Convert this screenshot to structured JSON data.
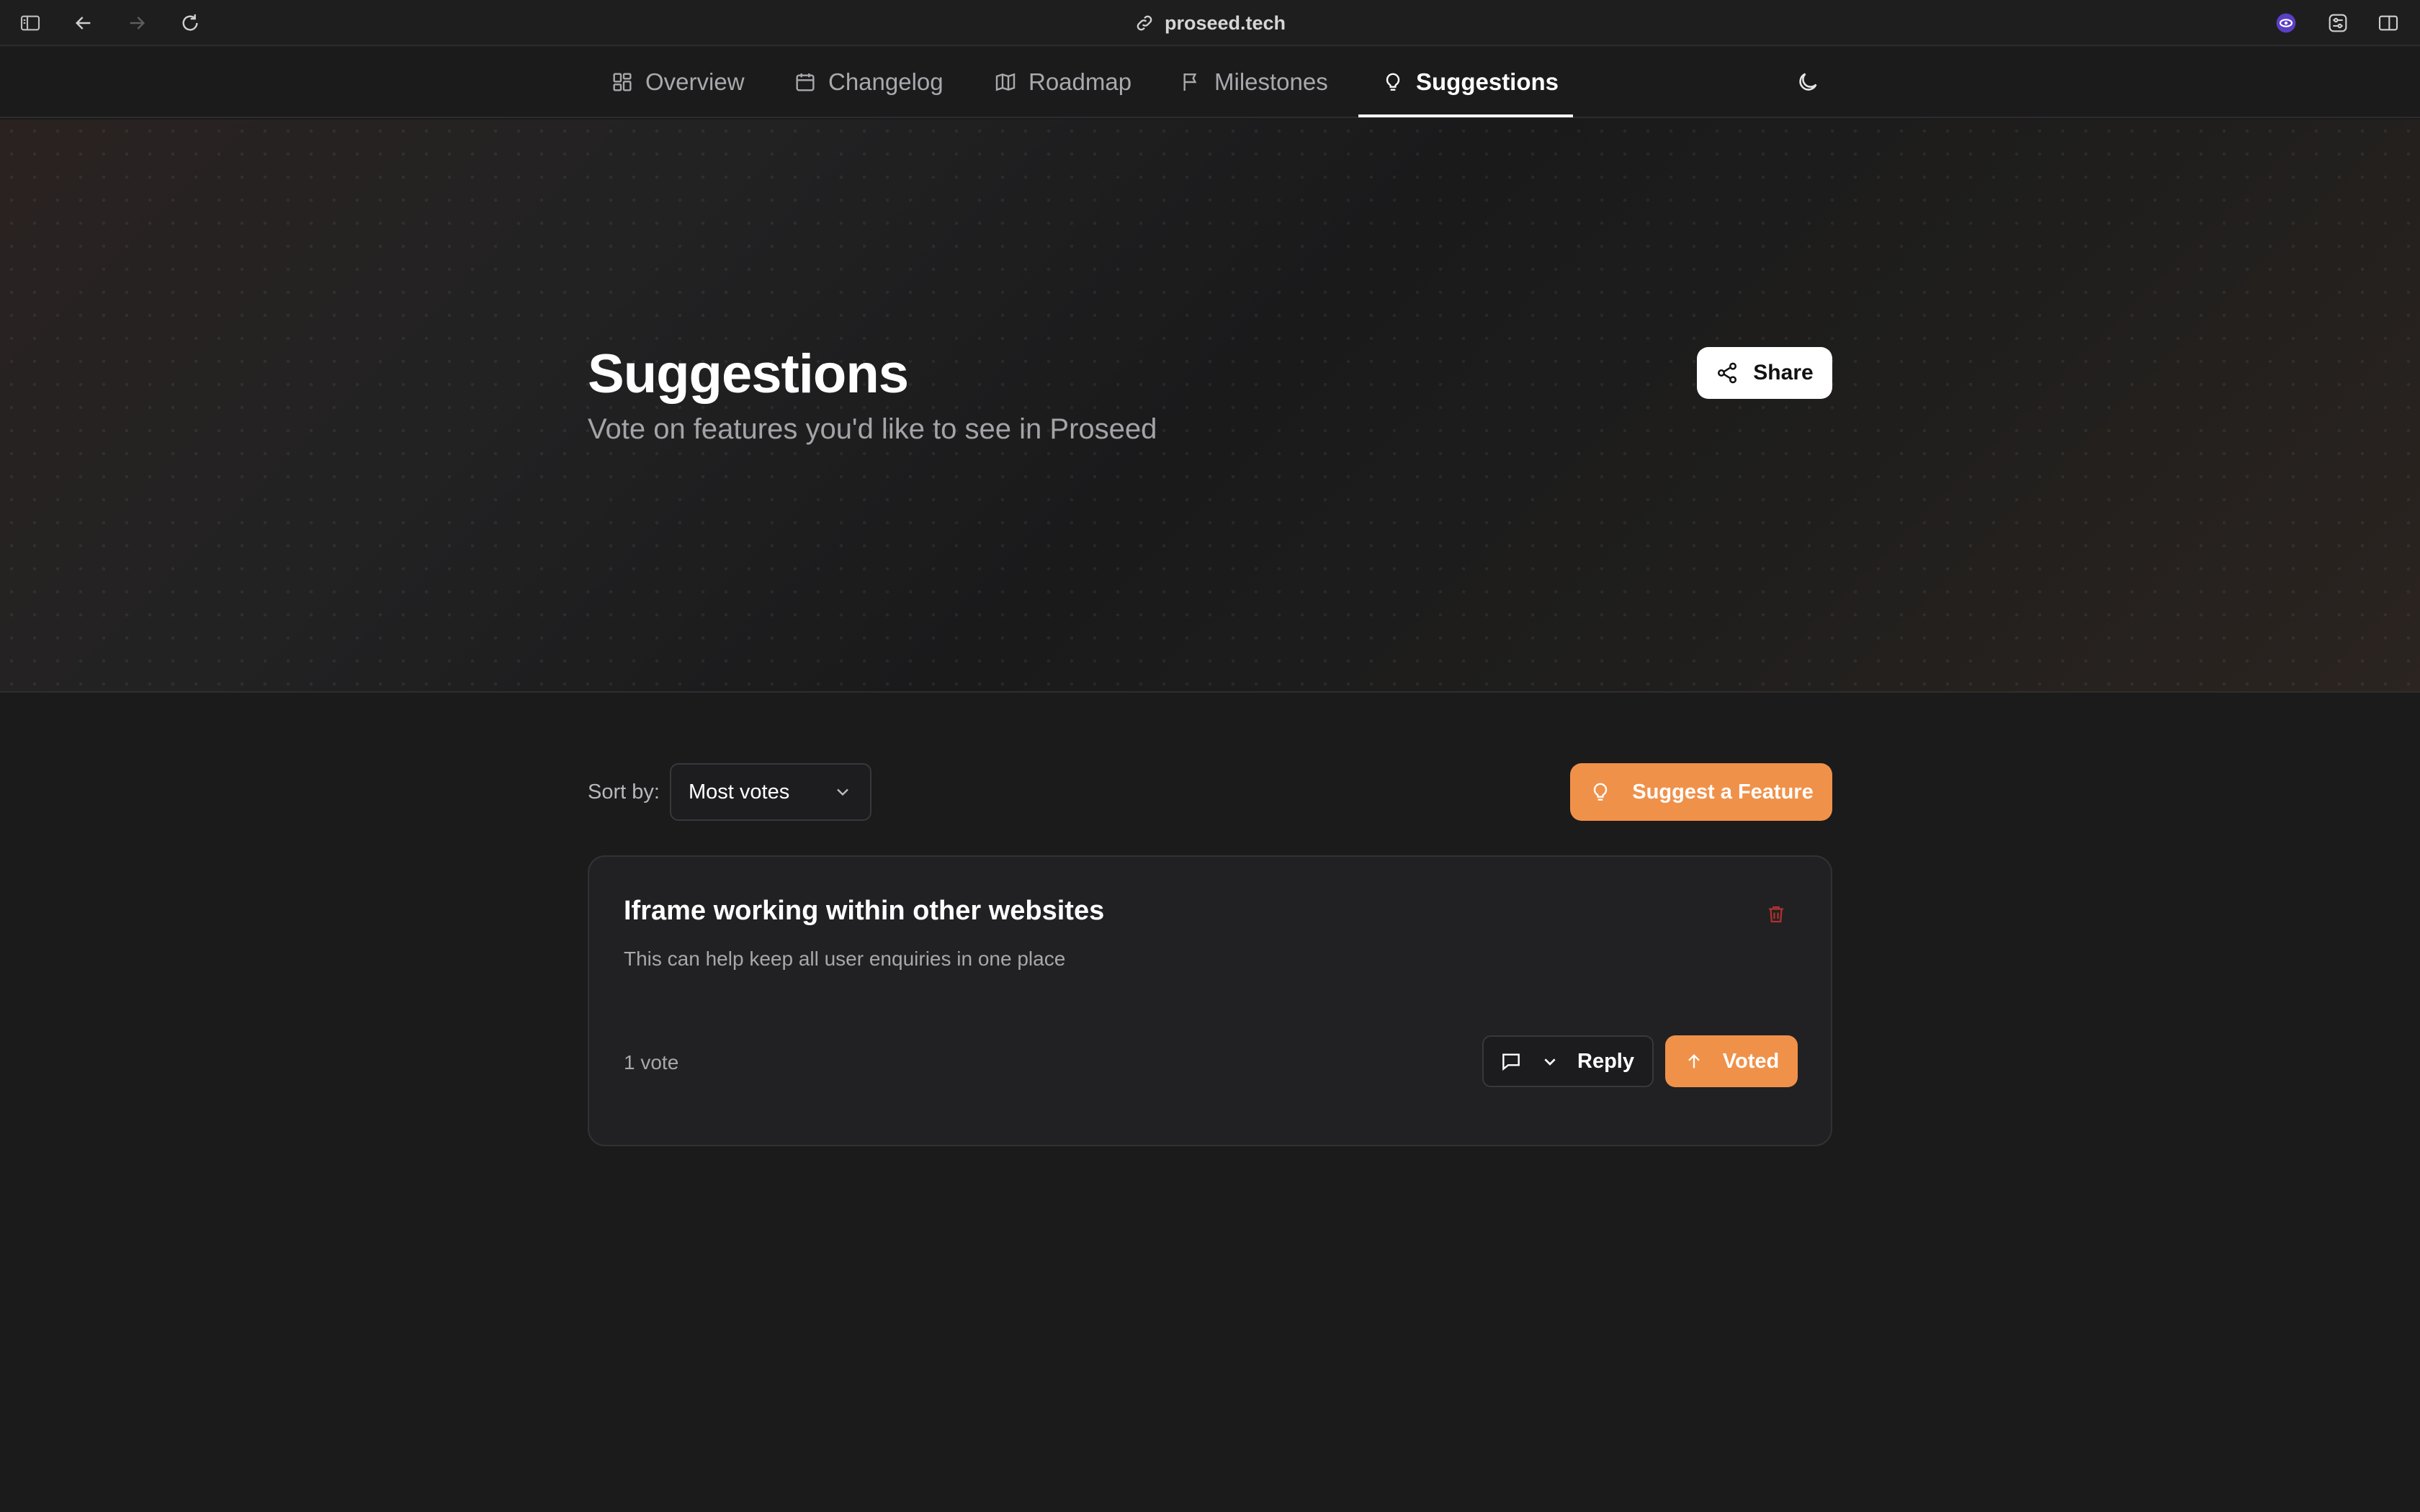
{
  "browser": {
    "url": "proseed.tech",
    "icons": [
      "sidebar-toggle-icon",
      "back-arrow-icon",
      "forward-arrow-icon",
      "reload-icon",
      "link-icon",
      "extension-icon",
      "settings-sliders-icon",
      "split-view-icon"
    ]
  },
  "nav": {
    "tabs": [
      {
        "label": "Overview",
        "icon": "grid-icon"
      },
      {
        "label": "Changelog",
        "icon": "calendar-icon"
      },
      {
        "label": "Roadmap",
        "icon": "map-icon"
      },
      {
        "label": "Milestones",
        "icon": "flag-icon"
      },
      {
        "label": "Suggestions",
        "icon": "lightbulb-icon",
        "active": true
      }
    ],
    "theme_icon": "moon-icon"
  },
  "hero": {
    "title": "Suggestions",
    "subtitle": "Vote on features you'd like to see in Proseed",
    "share_label": "Share"
  },
  "controls": {
    "sort_label": "Sort by:",
    "sort_value": "Most votes",
    "suggest_label": "Suggest a Feature"
  },
  "suggestions": [
    {
      "title": "Iframe working within other websites",
      "description": "This can help keep all user enquiries in one place",
      "votes": "1 vote",
      "reply_label": "Reply",
      "vote_label": "Voted"
    }
  ],
  "colors": {
    "accent": "#f0914a",
    "background": "#1b1b1c",
    "card": "#212123",
    "danger": "#b0322d"
  }
}
